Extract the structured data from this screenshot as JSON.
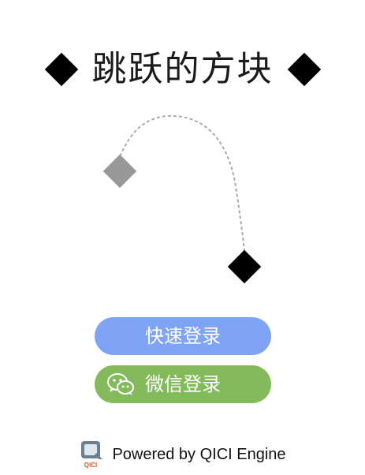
{
  "game": {
    "title": "跳跃的方块",
    "colors": {
      "title_diamond": "#000000",
      "ghost_block": "#999999",
      "player_block": "#000000",
      "trajectory": "#aaaaaa"
    }
  },
  "buttons": {
    "quick_login": {
      "label": "快速登录",
      "color": "#7FA3F5"
    },
    "wechat_login": {
      "label": "微信登录",
      "color": "#83BB5C",
      "icon": "wechat-icon"
    }
  },
  "footer": {
    "text": "Powered by QICI Engine",
    "logo_icon": "qici-engine-logo",
    "logo_text": "QICI"
  }
}
